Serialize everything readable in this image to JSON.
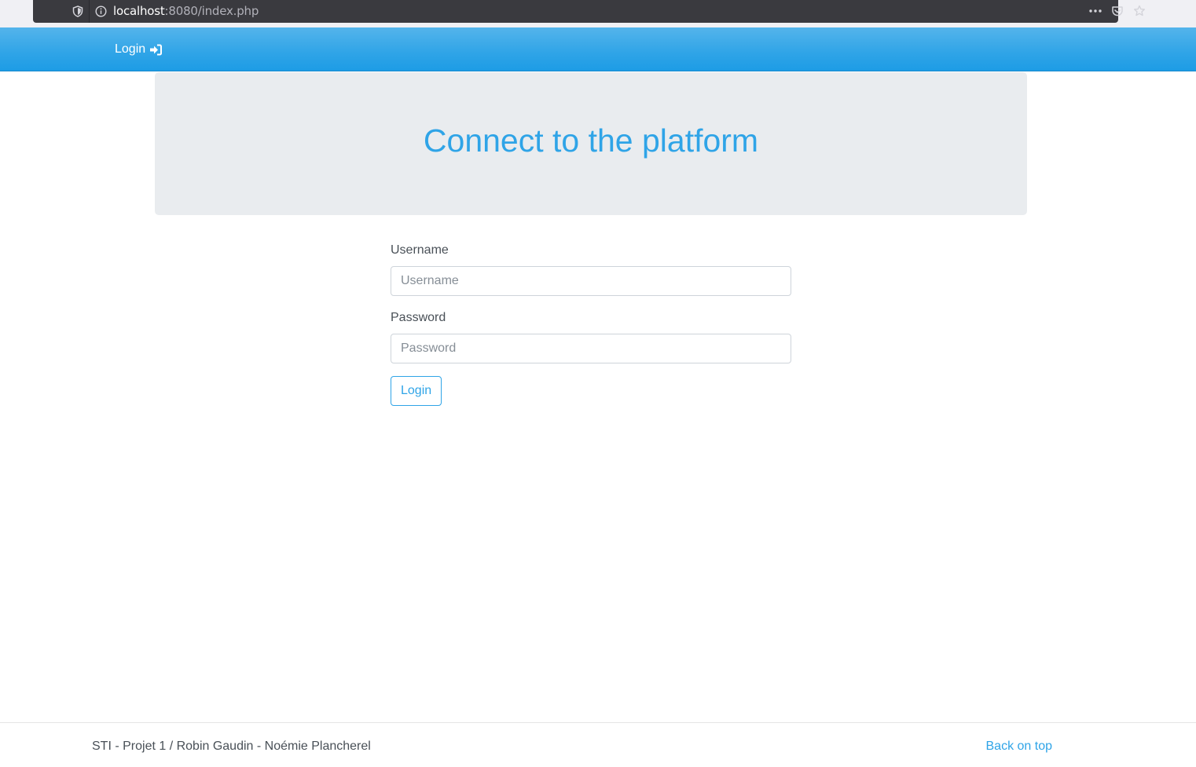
{
  "browser": {
    "url_host": "localhost",
    "url_rest": ":8080/index.php"
  },
  "navbar": {
    "login_label": "Login",
    "login_icon": "sign-in-icon"
  },
  "jumbotron": {
    "title": "Connect to the platform"
  },
  "form": {
    "username_label": "Username",
    "username_placeholder": "Username",
    "username_value": "",
    "password_label": "Password",
    "password_placeholder": "Password",
    "password_value": "",
    "submit_label": "Login"
  },
  "footer": {
    "credits": "STI - Projet 1 / Robin Gaudin - Noémie Plancherel",
    "back_on_top": "Back on top"
  },
  "colors": {
    "primary": "#2fa4e7",
    "jumbotron_bg": "#e9ecef",
    "text": "#495057"
  }
}
